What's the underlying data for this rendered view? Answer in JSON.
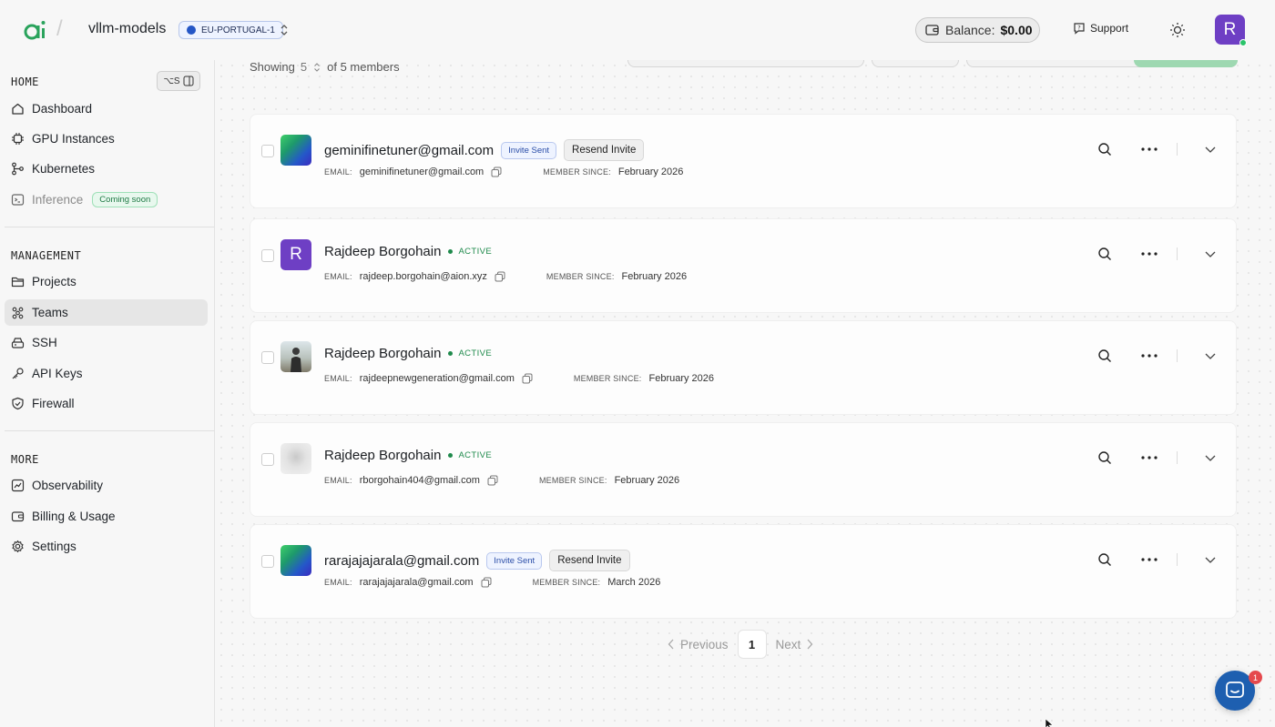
{
  "topbar": {
    "project_name": "vllm-models",
    "region": "EU-PORTUGAL-1",
    "balance_label": "Balance:",
    "balance_value": "$0.00",
    "support_label": "Support",
    "avatar_letter": "R"
  },
  "sidebar": {
    "home_title": "HOME",
    "shortcut": "⌥S",
    "home_items": [
      {
        "label": "Dashboard",
        "icon": "home-icon"
      },
      {
        "label": "GPU Instances",
        "icon": "chip-icon"
      },
      {
        "label": "Kubernetes",
        "icon": "branch-icon"
      },
      {
        "label": "Inference",
        "icon": "terminal-icon",
        "badge": "Coming soon"
      }
    ],
    "management_title": "MANAGEMENT",
    "management_items": [
      {
        "label": "Projects",
        "icon": "folder-icon"
      },
      {
        "label": "Teams",
        "icon": "team-icon",
        "active": true
      },
      {
        "label": "SSH",
        "icon": "server-icon"
      },
      {
        "label": "API Keys",
        "icon": "key-icon"
      },
      {
        "label": "Firewall",
        "icon": "shield-icon"
      }
    ],
    "more_title": "MORE",
    "more_items": [
      {
        "label": "Observability",
        "icon": "chart-icon"
      },
      {
        "label": "Billing & Usage",
        "icon": "wallet-icon"
      },
      {
        "label": "Settings",
        "icon": "gear-icon"
      }
    ]
  },
  "main": {
    "showing_label": "Showing",
    "page_size": "5",
    "showing_suffix": "of 5 members",
    "email_label": "EMAIL:",
    "member_since_label": "MEMBER SINCE:",
    "invite_badge": "Invite Sent",
    "resend_label": "Resend Invite",
    "active_label": "ACTIVE",
    "members": [
      {
        "name": "geminifinetuner@gmail.com",
        "email": "geminifinetuner@gmail.com",
        "since": "February 2026",
        "status": "invited"
      },
      {
        "name": "Rajdeep Borgohain",
        "email": "rajdeep.borgohain@aion.xyz",
        "since": "February 2026",
        "status": "active"
      },
      {
        "name": "Rajdeep Borgohain",
        "email": "rajdeepnewgeneration@gmail.com",
        "since": "February 2026",
        "status": "active"
      },
      {
        "name": "Rajdeep Borgohain",
        "email": "rborgohain404@gmail.com",
        "since": "February 2026",
        "status": "active"
      },
      {
        "name": "rarajajajarala@gmail.com",
        "email": "rarajajajarala@gmail.com",
        "since": "March 2026",
        "status": "invited"
      }
    ],
    "avatar_letter": "R",
    "pagination": {
      "previous": "Previous",
      "page": "1",
      "next": "Next"
    }
  },
  "chat": {
    "badge_count": "1"
  },
  "colors": {
    "accent": "#6e3fc4",
    "active_green": "#1f8a4c",
    "invite_blue": "#2b4ea8"
  }
}
